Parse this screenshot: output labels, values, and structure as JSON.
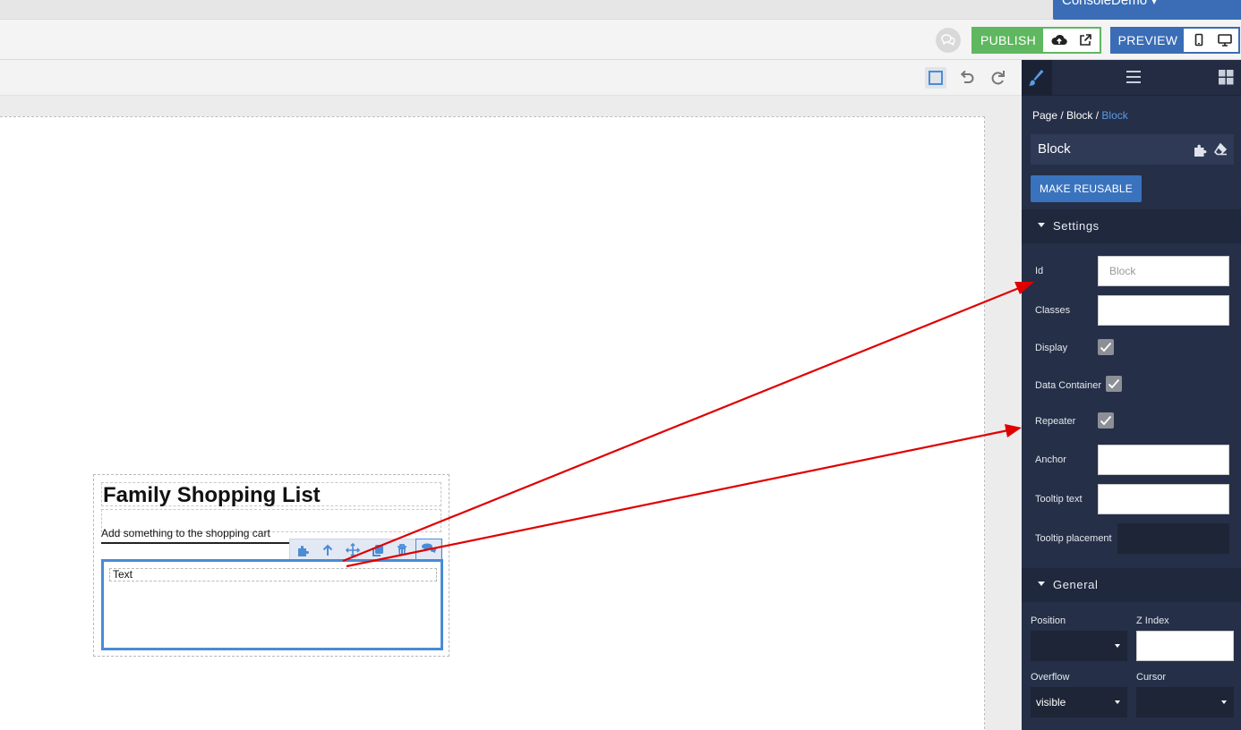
{
  "account": {
    "name": "ConsoleDemo ▾"
  },
  "toolbar": {
    "publish_label": "PUBLISH",
    "preview_label": "PREVIEW"
  },
  "canvas": {
    "heading": "Family Shopping List",
    "cart_text": "Add something to the shopping cart",
    "text_element": "Text"
  },
  "sidebar": {
    "breadcrumb": {
      "page": "Page",
      "sep": " / ",
      "parent": "Block",
      "current": "Block"
    },
    "block_name": "Block",
    "make_reusable_label": "MAKE REUSABLE",
    "settings": {
      "header": "Settings",
      "id_label": "Id",
      "id_placeholder": "Block",
      "classes_label": "Classes",
      "display_label": "Display",
      "display_checked": true,
      "data_container_label": "Data Container",
      "data_container_checked": true,
      "repeater_label": "Repeater",
      "repeater_checked": true,
      "anchor_label": "Anchor",
      "tooltip_text_label": "Tooltip text",
      "tooltip_placement_label": "Tooltip placement"
    },
    "general": {
      "header": "General",
      "position_label": "Position",
      "position_value": "",
      "z_index_label": "Z Index",
      "overflow_label": "Overflow",
      "overflow_value": "visible",
      "cursor_label": "Cursor",
      "cursor_value": ""
    }
  },
  "colors": {
    "publish_green": "#5fb760",
    "preview_blue": "#3a6db5",
    "sidebar_bg": "#252f47",
    "selection_blue": "#4a8cd6",
    "annotation_red": "#e00000"
  },
  "icons": [
    "chat-icon",
    "cloud-upload-icon",
    "external-link-icon",
    "mobile-icon",
    "desktop-icon",
    "select-box-icon",
    "undo-icon",
    "redo-icon",
    "brush-icon",
    "menu-icon",
    "grid-icon",
    "puzzle-icon",
    "eraser-icon",
    "arrow-up-icon",
    "move-icon",
    "copy-icon",
    "trash-icon",
    "comment-icon",
    "checkmark-icon"
  ]
}
